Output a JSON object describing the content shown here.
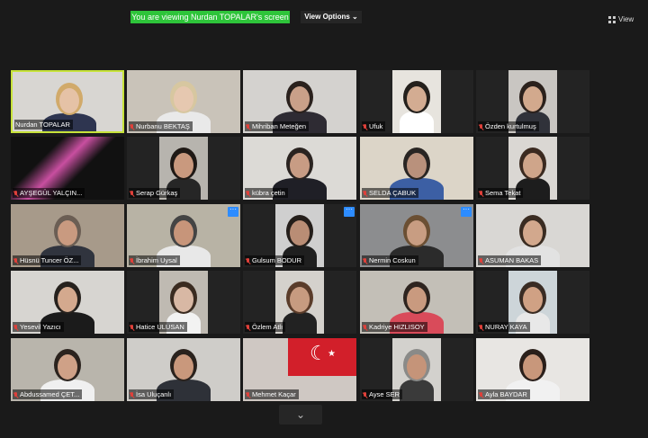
{
  "header": {
    "share_banner": "You are viewing Nurdan TOPALAR's screen",
    "view_options": "View Options ⌄",
    "view_button": "View"
  },
  "participants": [
    {
      "name": "Nurdan TOPALAR",
      "active": true
    },
    {
      "name": "Nurbanu BEKTAŞ"
    },
    {
      "name": "Mihriban Meteğen"
    },
    {
      "name": "Ufuk"
    },
    {
      "name": "Özden kurtulmuş"
    },
    {
      "name": "AYŞEGÜL YALÇIN..."
    },
    {
      "name": "Serap Gürkaş"
    },
    {
      "name": "kübra çetin"
    },
    {
      "name": "SELDA ÇABUK"
    },
    {
      "name": "Sema Tekat"
    },
    {
      "name": "Hüsnü Tuncer ÖZ..."
    },
    {
      "name": "İbrahim Uysal"
    },
    {
      "name": "Gulsum BODUR"
    },
    {
      "name": "Nermin Coskun"
    },
    {
      "name": "ASUMAN BAKAS"
    },
    {
      "name": "Yesevil Yazıcı"
    },
    {
      "name": "Hatice ULUSAN"
    },
    {
      "name": "Özlem Atlı"
    },
    {
      "name": "Kadriye HIZLISOY"
    },
    {
      "name": "NURAY KAYA"
    },
    {
      "name": "Abdussamed ÇET..."
    },
    {
      "name": "İsa Uluçanlı"
    },
    {
      "name": "Mehmet Kaçar"
    },
    {
      "name": "Ayse SER"
    },
    {
      "name": "Ayla BAYDAR"
    }
  ],
  "colors": {
    "active_border": "#c7e33a",
    "banner": "#2ec43a",
    "more_button": "#2d8cff",
    "muted_mic": "#e0403a"
  },
  "icons": {
    "mic": "muted-mic-icon",
    "more": "more-options-icon",
    "grid": "gallery-grid-icon",
    "scroll": "chevron-down-icon"
  }
}
